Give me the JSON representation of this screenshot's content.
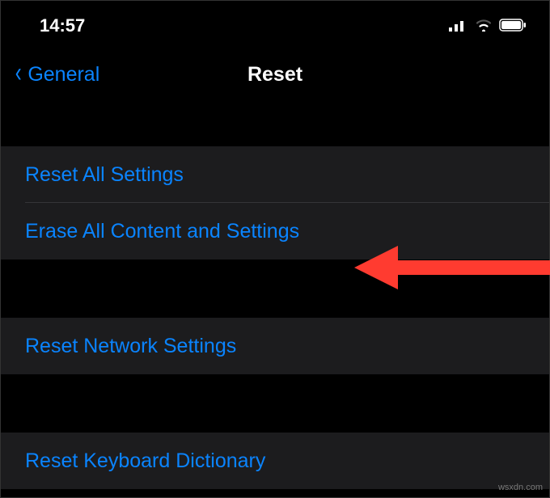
{
  "status": {
    "time": "14:57"
  },
  "nav": {
    "back_label": "General",
    "title": "Reset"
  },
  "groups": [
    {
      "rows": [
        {
          "label": "Reset All Settings"
        },
        {
          "label": "Erase All Content and Settings"
        }
      ]
    },
    {
      "rows": [
        {
          "label": "Reset Network Settings"
        }
      ]
    },
    {
      "rows": [
        {
          "label": "Reset Keyboard Dictionary"
        }
      ]
    }
  ],
  "annotation": {
    "color": "#ff3b30"
  },
  "watermark": "wsxdn.com"
}
